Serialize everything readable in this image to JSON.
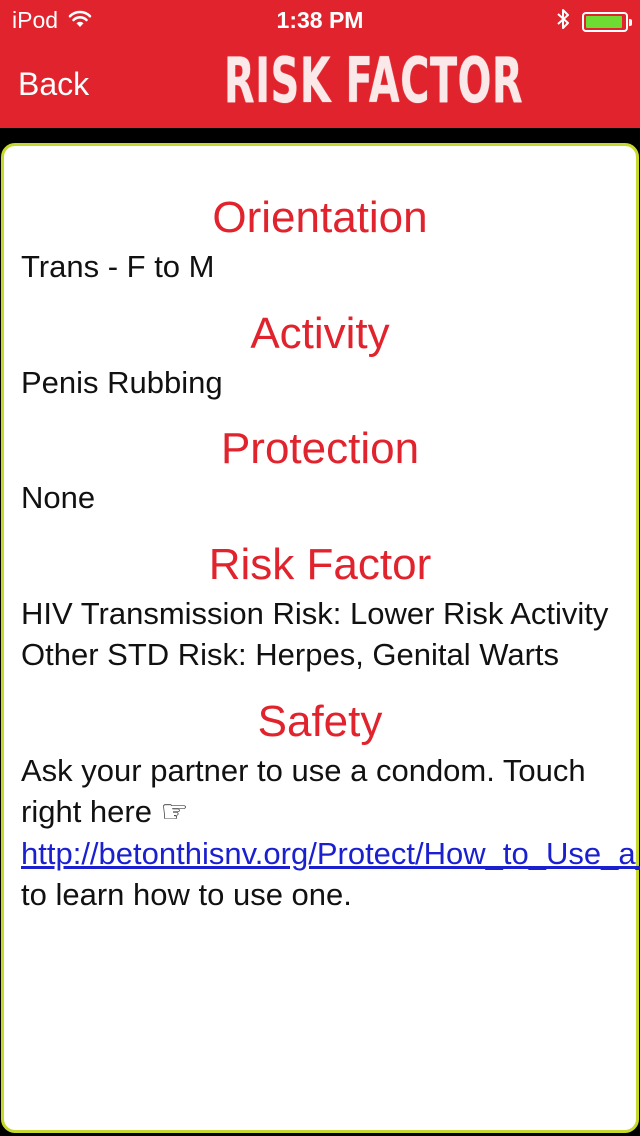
{
  "status_bar": {
    "carrier": "iPod",
    "time": "1:38 PM",
    "battery_level": 0.95
  },
  "nav": {
    "back_label": "Back",
    "title": "RISK FACTOR"
  },
  "colors": {
    "accent_red": "#e0232c",
    "card_border": "#c7d82d",
    "link_blue": "#1a1fd0",
    "battery_green": "#6fdc34"
  },
  "sections": {
    "orientation": {
      "heading": "Orientation",
      "text": "Trans - F to M"
    },
    "activity": {
      "heading": "Activity",
      "text": "Penis Rubbing"
    },
    "protection": {
      "heading": "Protection",
      "text": "None"
    },
    "risk_factor": {
      "heading": "Risk Factor",
      "text": "HIV Transmission Risk: Lower Risk Activity  Other STD Risk: Herpes, Genital Warts"
    },
    "safety": {
      "heading": "Safety",
      "text_before": "Ask your partner to use a condom. Touch right here ☞ ",
      "link": "http://betonthisnv.org/Protect/How_to_Use_a_Condom/",
      "text_after": " to learn how to use one."
    }
  }
}
